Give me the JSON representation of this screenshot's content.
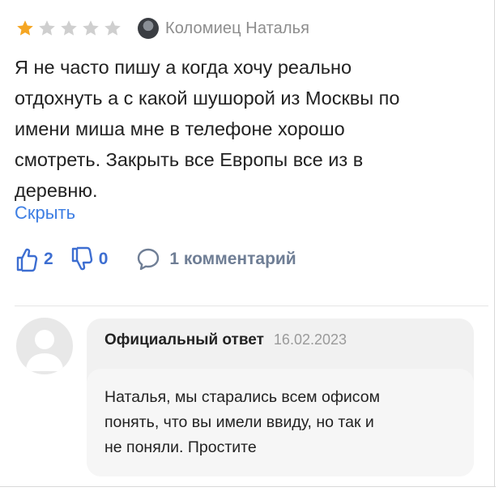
{
  "review": {
    "rating": 1,
    "max_rating": 5,
    "author": "Коломиец Наталья",
    "text_lines": [
      "Я не часто пишу а когда хочу реально",
      "отдохнуть а с какой шушорой из Москвы по",
      "имени миша мне в телефоне хорошо",
      "смотреть.  Закрыть все Европы все из в",
      "деревню."
    ],
    "collapse_label": "Скрыть",
    "likes": "2",
    "dislikes": "0",
    "comments_label": "1 комментарий"
  },
  "official_reply": {
    "label": "Официальный ответ",
    "date": "16.02.2023",
    "text_lines": [
      "Наталья, мы старались всем офисом",
      "понять, что вы имели ввиду, но так и",
      "не поняли. Простите"
    ]
  },
  "icons": {
    "star_filled": "star-icon",
    "star_empty": "star-outline-icon",
    "like": "thumbs-up-icon",
    "dislike": "thumbs-down-icon",
    "comment": "comment-bubble-icon",
    "avatar": "user-avatar-icon"
  },
  "colors": {
    "star_filled": "#f5a623",
    "star_empty": "#cfcfcf",
    "link": "#3d7ee3",
    "reaction": "#3d6ed1",
    "comments": "#6f7e95",
    "reply_card": "#f1f1f1"
  }
}
